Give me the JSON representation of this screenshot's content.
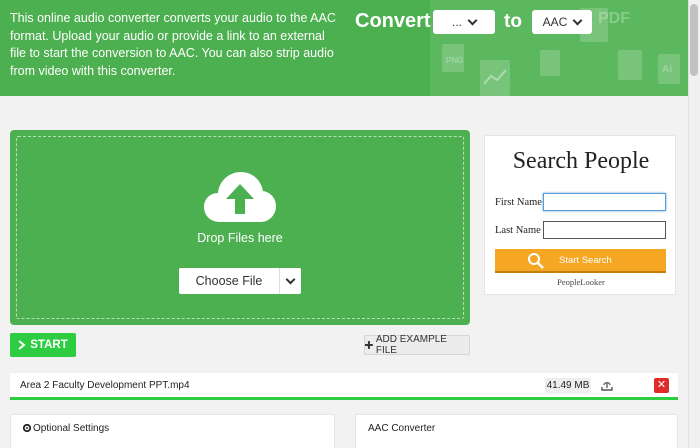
{
  "header": {
    "description": "This online audio converter converts your audio to the AAC format. Upload your audio or provide a link to an external file to start the conversion to AAC. You can also strip audio from video with this converter.",
    "convert_label": "Convert",
    "from_value": "...",
    "to_label": "to",
    "to_value": "AAC",
    "decor_pdf": "PDF",
    "decor_png": "PNG",
    "decor_ai": "Ai"
  },
  "upload": {
    "drop_label": "Drop Files here",
    "choose_label": "Choose File"
  },
  "search_card": {
    "title": "Search People",
    "first_name_label": "First Name",
    "first_name_value": "",
    "last_name_label": "Last Name",
    "last_name_value": "",
    "button_label": "Start Search",
    "footer": "PeopleLooker"
  },
  "actions": {
    "start_label": "START",
    "example_label": "ADD EXAMPLE FILE"
  },
  "file": {
    "name": "Area 2 Faculty Development PPT.mp4",
    "size": "41.49 MB",
    "remove_symbol": "✕"
  },
  "panels": {
    "optional_settings": "Optional Settings",
    "aac_converter": "AAC Converter"
  },
  "colors": {
    "brand_green": "#4caf50",
    "start_green": "#2ecc40",
    "search_orange": "#f5a623",
    "danger_red": "#e02b2b"
  }
}
